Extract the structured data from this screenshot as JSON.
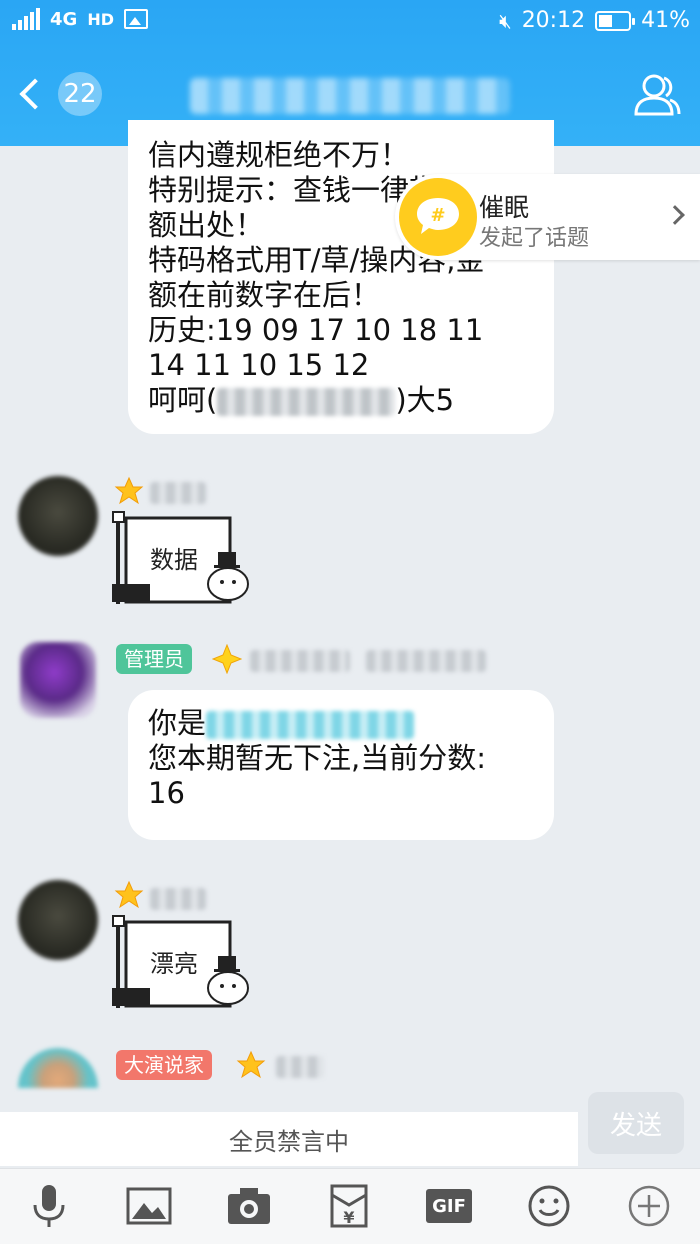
{
  "status_bar": {
    "network": "4G",
    "hd": "HD",
    "time": "20:12",
    "battery": "41%"
  },
  "header": {
    "unread_count": "22"
  },
  "messages": {
    "first": {
      "lines": [
        "信内遵规柜绝不万！",
        "特别提示：查钱一律带上金",
        "额出处！",
        "特码格式用T/草/操内容,金",
        "额在前数字在后！",
        "历史:19 09 17 10 18 11",
        "14 11 10 15 12"
      ],
      "last_prefix": "呵呵(",
      "last_suffix": ")大5"
    },
    "sticker1_text": "数据",
    "admin_tag": "管理员",
    "second": {
      "line1_prefix": "你是",
      "line2": "您本期暂无下注,当前分数:",
      "line3": "16"
    },
    "sticker2_text": "漂亮",
    "speaker_tag": "大演说家"
  },
  "topic_popup": {
    "title": "催眠",
    "subtitle": "发起了话题"
  },
  "input": {
    "muted_text": "全员禁言中",
    "send_label": "发送"
  },
  "toolbar": {
    "gif_label": "GIF"
  },
  "colors": {
    "header_blue": "#2aa6f4",
    "background": "#e9edf1",
    "admin_tag": "#4fc59a",
    "speaker_tag": "#f2776b",
    "topic_yellow": "#ffcc1e"
  }
}
